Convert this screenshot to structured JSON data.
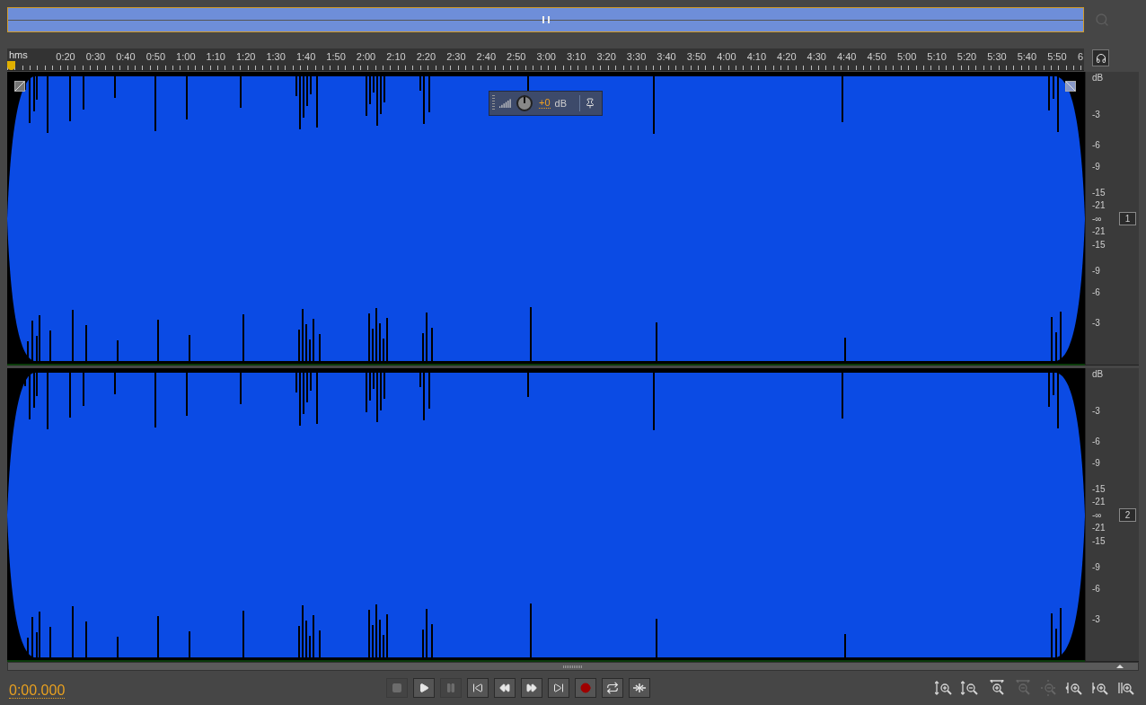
{
  "overview": {
    "zoom_out_disabled": true
  },
  "ruler": {
    "unit": "hms",
    "labels": [
      "0:20",
      "0:30",
      "0:40",
      "0:50",
      "1:00",
      "1:10",
      "1:20",
      "1:30",
      "1:40",
      "1:50",
      "2:00",
      "2:10",
      "2:20",
      "2:30",
      "2:40",
      "2:50",
      "3:00",
      "3:10",
      "3:20",
      "3:30",
      "3:40",
      "3:50",
      "4:00",
      "4:10",
      "4:20",
      "4:30",
      "4:40",
      "4:50",
      "5:00",
      "5:10",
      "5:20",
      "5:30",
      "5:40",
      "5:50"
    ],
    "end_label": "6"
  },
  "volume_hud": {
    "value": "+0",
    "unit": "dB"
  },
  "channels": [
    {
      "label": "1",
      "fade_handles": true,
      "scale": [
        "dB",
        "-3",
        "-6",
        "-9",
        "-15",
        "-21",
        "-∞",
        "-21",
        "-15",
        "-9",
        "-6",
        "-3"
      ]
    },
    {
      "label": "2",
      "fade_handles": false,
      "scale": [
        "dB",
        "-3",
        "-6",
        "-9",
        "-15",
        "-21",
        "-∞",
        "-21",
        "-15",
        "-9",
        "-6",
        "-3"
      ]
    }
  ],
  "time": "0:00.000",
  "transport": [
    {
      "kind": "stop",
      "disabled": true
    },
    {
      "kind": "play",
      "disabled": false
    },
    {
      "kind": "pause",
      "disabled": true
    },
    {
      "kind": "start",
      "disabled": false
    },
    {
      "kind": "rewind",
      "disabled": false
    },
    {
      "kind": "forward",
      "disabled": false
    },
    {
      "kind": "end",
      "disabled": false
    },
    {
      "kind": "record",
      "disabled": false
    },
    {
      "kind": "loop",
      "disabled": false
    },
    {
      "kind": "skip",
      "disabled": false
    }
  ],
  "zoom": [
    {
      "kind": "in-amplitude",
      "disabled": false
    },
    {
      "kind": "out-amplitude",
      "disabled": false
    },
    {
      "kind": "in-time",
      "disabled": false
    },
    {
      "kind": "out-time",
      "disabled": true
    },
    {
      "kind": "out-full",
      "disabled": true
    },
    {
      "kind": "in-start",
      "disabled": false
    },
    {
      "kind": "in-end",
      "disabled": false
    },
    {
      "kind": "in-selection",
      "disabled": false
    }
  ]
}
